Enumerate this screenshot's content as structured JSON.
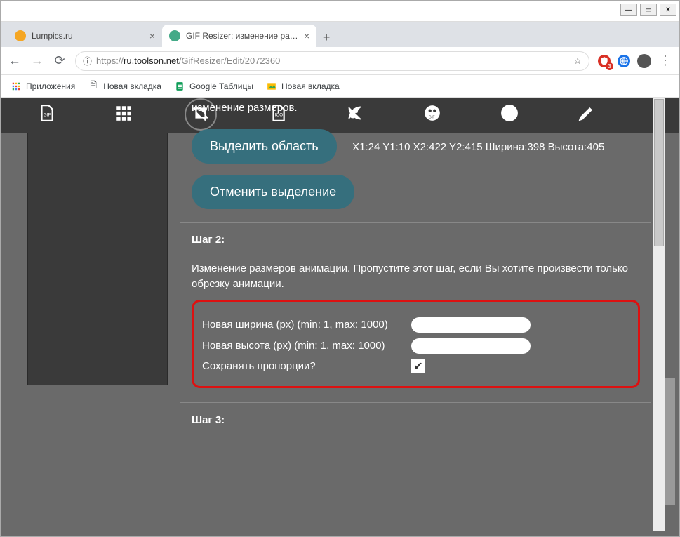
{
  "window": {
    "tabs": [
      {
        "title": "Lumpics.ru",
        "favicon_color": "#f5a623"
      },
      {
        "title": "GIF Resizer: изменение размера",
        "favicon_color": "#4a8"
      }
    ],
    "controls": {
      "min": "—",
      "max": "▭",
      "close": "✕"
    }
  },
  "addressbar": {
    "url_prefix": "https://",
    "url_host": "ru.toolson.net",
    "url_path": "/GifResizer/Edit/2072360",
    "star": "☆"
  },
  "extensions": {
    "badge_count": "3"
  },
  "bookmarks": [
    {
      "icon": "apps",
      "label": "Приложения"
    },
    {
      "icon": "page",
      "label": "Новая вкладка"
    },
    {
      "icon": "sheets",
      "label": "Google Таблицы"
    },
    {
      "icon": "image",
      "label": "Новая вкладка"
    }
  ],
  "toolbar_icons": [
    "gif-icon",
    "grid-icon",
    "crop-icon",
    "ico-icon",
    "raw-jpg-icon",
    "gif-film-icon",
    "music-icon",
    "pencil-icon"
  ],
  "content": {
    "top_line": "изменение размеров.",
    "select_area_btn": "Выделить область",
    "coords_text": "X1:24 Y1:10 X2:422 Y2:415 Ширина:398 Высота:405",
    "clear_selection_btn": "Отменить выделение",
    "step2_title": "Шаг 2:",
    "step2_desc": "Изменение размеров анимации. Пропустите этот шаг, если Вы хотите произвести только обрезку анимации.",
    "width_label": "Новая ширина (px) (min: 1, max: 1000)",
    "height_label": "Новая высота (px) (min: 1, max: 1000)",
    "keep_ratio_label": "Сохранять пропорции?",
    "keep_ratio_checked": true,
    "step3_title": "Шаг 3:"
  }
}
